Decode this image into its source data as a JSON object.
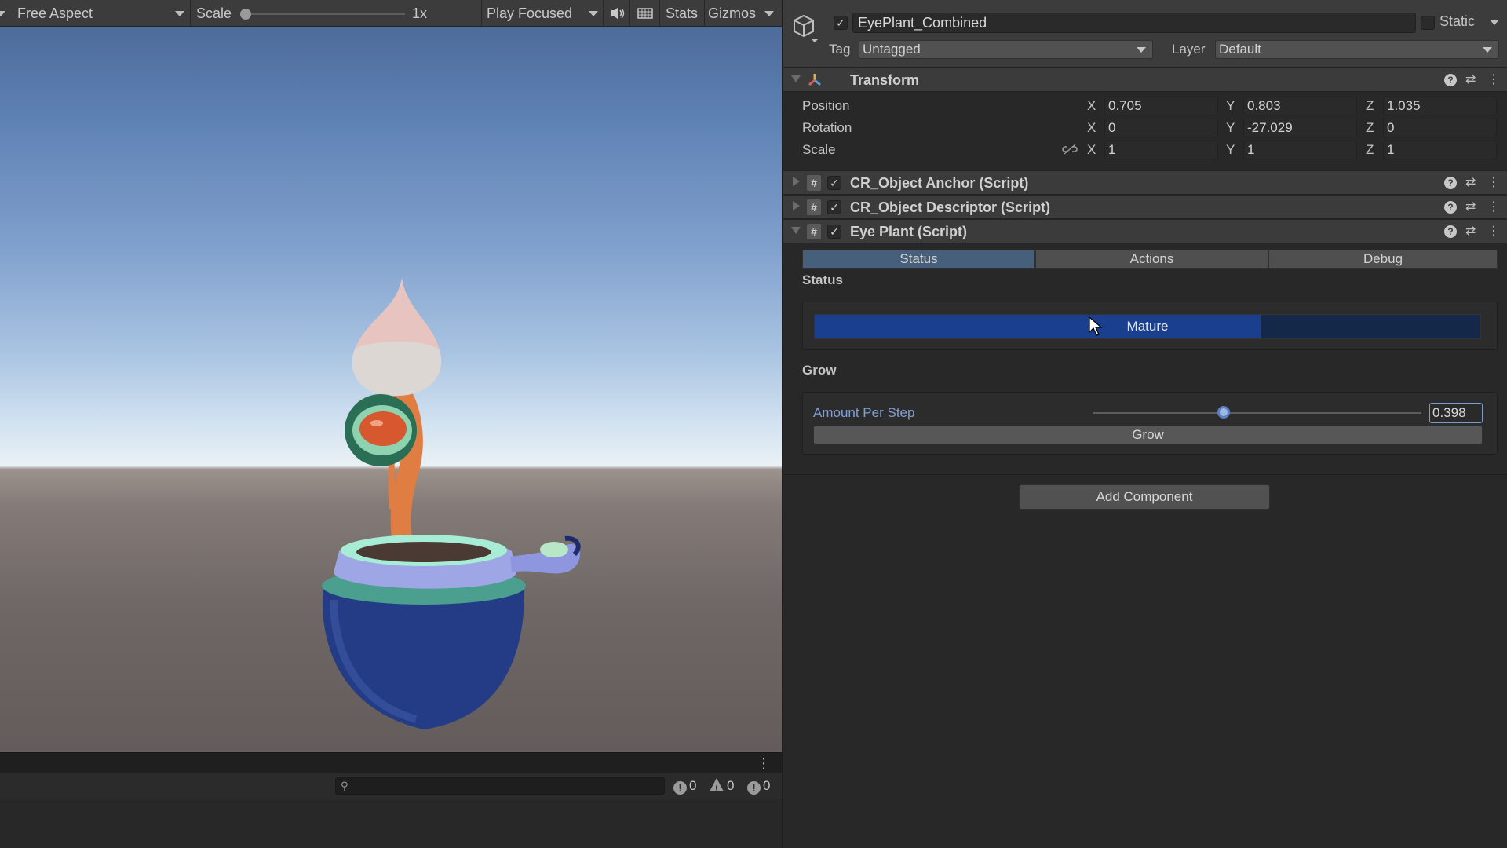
{
  "game_toolbar": {
    "aspect": "Free Aspect",
    "scale_label": "Scale",
    "scale_value": "1x",
    "scale_fraction": 0.0,
    "play_mode": "Play Focused",
    "stats": "Stats",
    "gizmos": "Gizmos",
    "icons": {
      "audio": "audio-mute-icon",
      "grid": "aspect-grid-icon"
    }
  },
  "console": {
    "menu": "⋮",
    "search_icon": "search-icon",
    "info_count": "0",
    "warning_count": "0",
    "error_count": "0"
  },
  "inspector": {
    "object_name": "EyePlant_Combined",
    "object_enabled": true,
    "static_label": "Static",
    "static_checked": false,
    "tag_label": "Tag",
    "tag_value": "Untagged",
    "layer_label": "Layer",
    "layer_value": "Default",
    "transform": {
      "title": "Transform",
      "rows": [
        {
          "label": "Position",
          "x": "0.705",
          "y": "0.803",
          "z": "1.035"
        },
        {
          "label": "Rotation",
          "x": "0",
          "y": "-27.029",
          "z": "0"
        },
        {
          "label": "Scale",
          "x": "1",
          "y": "1",
          "z": "1"
        }
      ],
      "axis_x": "X",
      "axis_y": "Y",
      "axis_z": "Z"
    },
    "components": [
      {
        "title": "CR_Object Anchor (Script)",
        "enabled": true,
        "expanded": false
      },
      {
        "title": "CR_Object Descriptor (Script)",
        "enabled": true,
        "expanded": false
      },
      {
        "title": "Eye Plant (Script)",
        "enabled": true,
        "expanded": true
      }
    ],
    "eye_plant": {
      "tabs": [
        "Status",
        "Actions",
        "Debug"
      ],
      "active_tab": "Status",
      "status_section": "Status",
      "status_text": "Mature",
      "status_fraction": 0.67,
      "grow_section": "Grow",
      "amount_label": "Amount Per Step",
      "amount_value": "0.398",
      "amount_fraction": 0.398,
      "grow_button": "Grow"
    },
    "add_component": "Add Component"
  },
  "colors": {
    "accent": "#46607c",
    "status_fill": "#1b3f8f",
    "slider_knob": "#9db7e3"
  }
}
